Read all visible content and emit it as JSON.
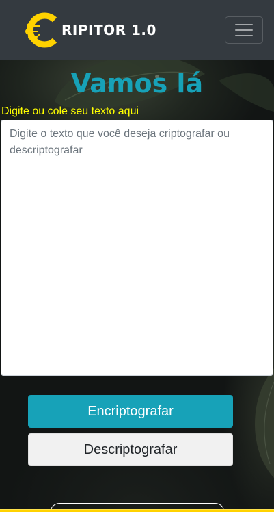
{
  "header": {
    "brand_text": "RIPITOR 1.0",
    "brand_letter": "C",
    "logo_icon": "circuit-c-logo-icon",
    "menu_icon": "hamburger-menu-icon",
    "accent_color": "#ffd200",
    "background_color": "#343a40"
  },
  "main": {
    "title": "Vamos lá",
    "input_label": "Digite ou cole seu texto aqui",
    "textarea_value": "",
    "textarea_placeholder": "Digite o texto que você deseja criptografar ou descriptografar",
    "encrypt_button": "Encriptografar",
    "decrypt_button": "Descriptografar",
    "title_color": "#17a2b8",
    "label_color": "#ffff00"
  }
}
